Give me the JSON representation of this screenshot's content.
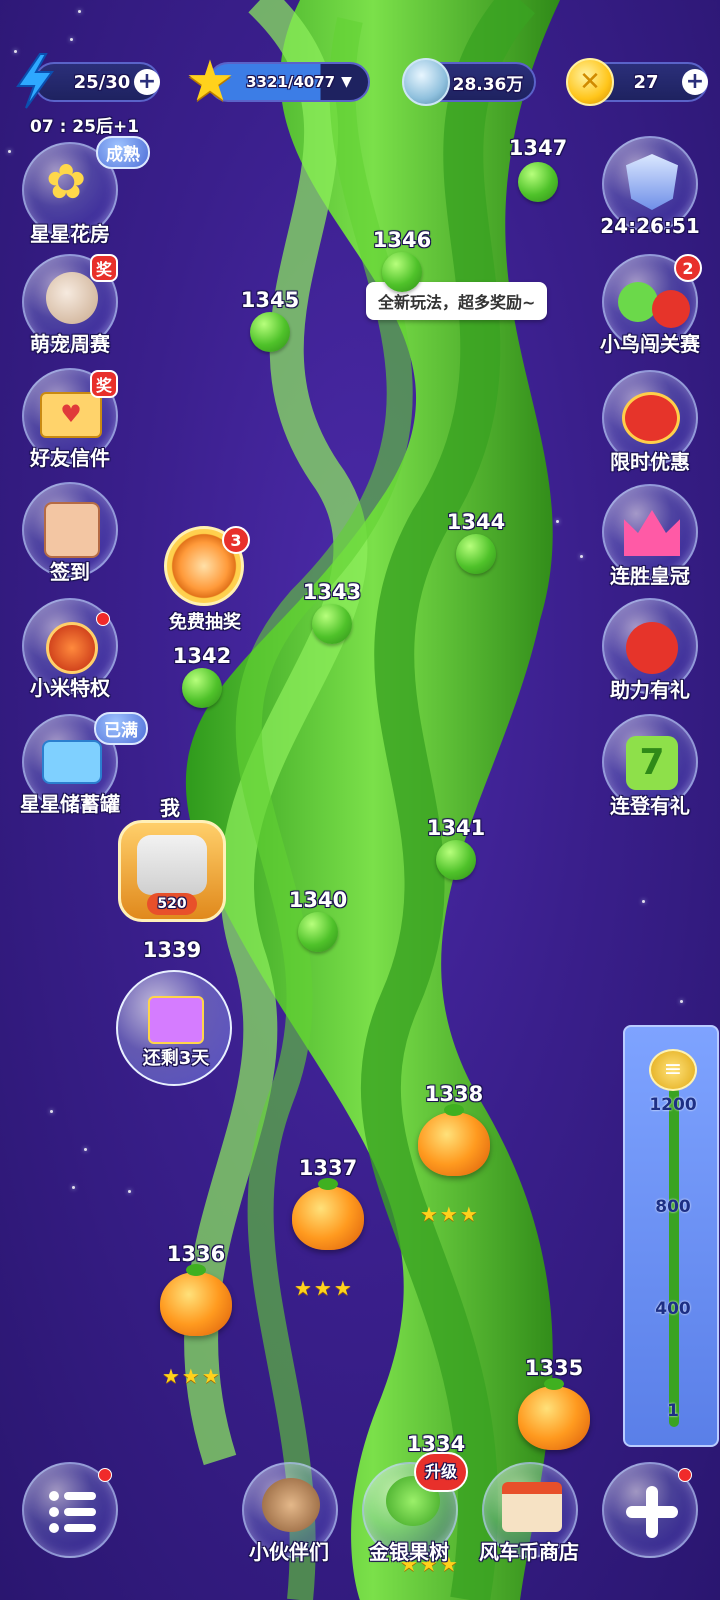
{
  "top": {
    "energy": "25/30",
    "timer": "07 : 25后+1",
    "stars": "3321/4077",
    "coins": "28.36万",
    "gems": "27"
  },
  "left_menu": [
    {
      "label": "星星花房",
      "tag": "成熟"
    },
    {
      "label": "萌宠周赛",
      "tag": "奖"
    },
    {
      "label": "好友信件",
      "tag": "奖"
    },
    {
      "label": "签到"
    },
    {
      "label": "小米特权"
    },
    {
      "label": "星星储蓄罐",
      "tag": "已满"
    }
  ],
  "right_menu": [
    {
      "label": "24:26:51"
    },
    {
      "label": "小鸟闯关赛",
      "badge": "2"
    },
    {
      "label": "限时优惠"
    },
    {
      "label": "连胜皇冠"
    },
    {
      "label": "助力有礼"
    },
    {
      "label": "连登有礼"
    }
  ],
  "tooltip": "全新玩法，超多奖励~",
  "lottery": {
    "label": "免费抽奖",
    "badge": "3"
  },
  "player": {
    "me": "我",
    "score": "520"
  },
  "gift": {
    "label": "还剩3天"
  },
  "levels": {
    "l1347": "1347",
    "l1346": "1346",
    "l1345": "1345",
    "l1344": "1344",
    "l1343": "1343",
    "l1342": "1342",
    "l1341": "1341",
    "l1340": "1340",
    "l1339": "1339",
    "l1338": "1338",
    "l1337": "1337",
    "l1336": "1336",
    "l1335": "1335",
    "l1334": "1334"
  },
  "stars_icon": "★★★",
  "tower": [
    "1200",
    "800",
    "400",
    "1"
  ],
  "bottom": {
    "partners": "小伙伴们",
    "tree": "金银果树",
    "tree_tag": "升级",
    "shop": "风车币商店"
  },
  "icons": {
    "menu": "list-icon",
    "add": "plus-icon"
  },
  "colors": {
    "background": "#3a1f8c",
    "vine": "#4fc22a",
    "badge": "#e8302b"
  }
}
